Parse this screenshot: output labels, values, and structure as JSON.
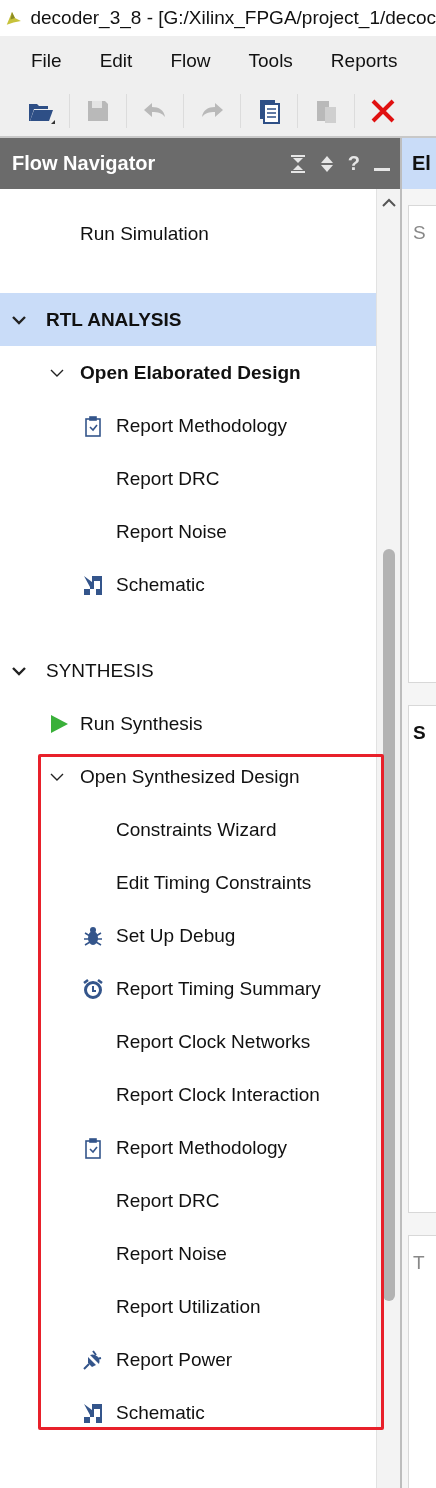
{
  "window": {
    "title": "decoder_3_8 - [G:/Xilinx_FPGA/project_1/decoc"
  },
  "menu": [
    {
      "label": "File"
    },
    {
      "label": "Edit"
    },
    {
      "label": "Flow"
    },
    {
      "label": "Tools"
    },
    {
      "label": "Reports"
    }
  ],
  "toolbar": [
    {
      "kind": "open",
      "disabled": false
    },
    {
      "kind": "save",
      "disabled": true
    },
    {
      "kind": "undo",
      "disabled": true
    },
    {
      "kind": "redo",
      "disabled": true
    },
    {
      "kind": "copy",
      "disabled": false
    },
    {
      "kind": "paste",
      "disabled": true
    },
    {
      "kind": "close",
      "disabled": false
    }
  ],
  "navigator": {
    "title": "Flow Navigator",
    "help": "?",
    "sections": [
      {
        "children": [
          {
            "label": "Run Simulation",
            "kind": "plain"
          }
        ]
      },
      {
        "label": "RTL ANALYSIS",
        "expanded": true,
        "selected": true,
        "active": true,
        "children": [
          {
            "label": "Open Elaborated Design",
            "kind": "group",
            "expanded": true,
            "active": true,
            "highlighted": false,
            "children": [
              {
                "label": "Report Methodology",
                "kind": "checklist"
              },
              {
                "label": "Report DRC",
                "kind": "plain"
              },
              {
                "label": "Report Noise",
                "kind": "plain"
              },
              {
                "label": "Schematic",
                "kind": "schematic"
              }
            ]
          }
        ]
      },
      {
        "label": "SYNTHESIS",
        "expanded": true,
        "selected": false,
        "active": false,
        "children": [
          {
            "label": "Run Synthesis",
            "kind": "play"
          },
          {
            "label": "Open Synthesized Design",
            "kind": "group",
            "expanded": true,
            "active": false,
            "highlighted": true,
            "children": [
              {
                "label": "Constraints Wizard",
                "kind": "plain"
              },
              {
                "label": "Edit Timing Constraints",
                "kind": "plain"
              },
              {
                "label": "Set Up Debug",
                "kind": "bug"
              },
              {
                "label": "Report Timing Summary",
                "kind": "timer"
              },
              {
                "label": "Report Clock Networks",
                "kind": "plain"
              },
              {
                "label": "Report Clock Interaction",
                "kind": "plain"
              },
              {
                "label": "Report Methodology",
                "kind": "checklist"
              },
              {
                "label": "Report DRC",
                "kind": "plain"
              },
              {
                "label": "Report Noise",
                "kind": "plain"
              },
              {
                "label": "Report Utilization",
                "kind": "plain"
              },
              {
                "label": "Report Power",
                "kind": "plug"
              },
              {
                "label": "Schematic",
                "kind": "schematic"
              }
            ]
          }
        ]
      }
    ]
  },
  "side_panel": {
    "title": "El",
    "sections": [
      {
        "label": "S",
        "bold": false
      },
      {
        "label": "S",
        "bold": true
      },
      {
        "label": "T",
        "bold": false
      }
    ]
  }
}
